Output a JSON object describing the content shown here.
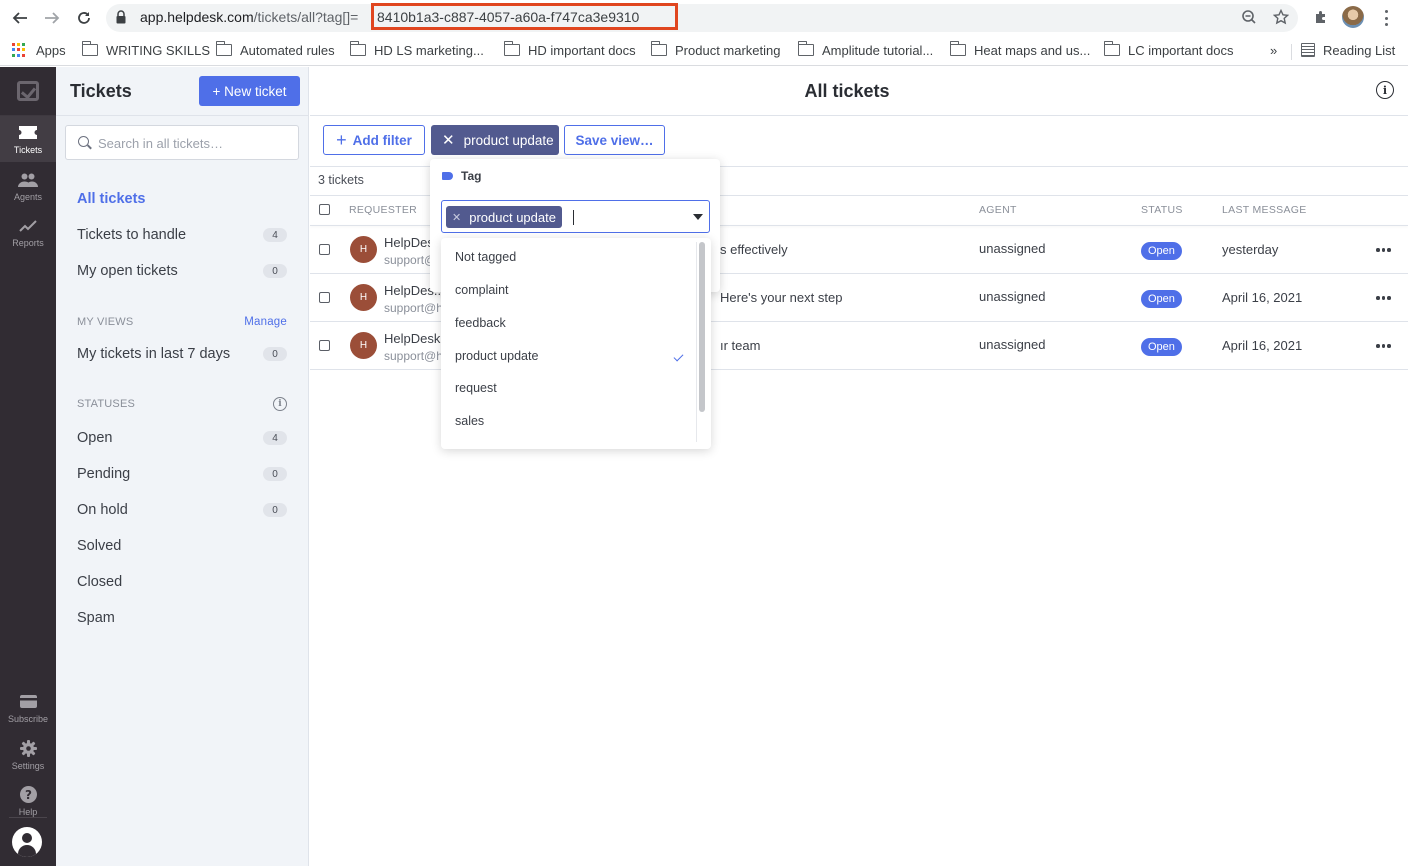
{
  "browser": {
    "url_host": "app.helpdesk.com",
    "url_path": "/tickets/all?tag[]=",
    "url_tag_id": "8410b1a3-c887-4057-a60a-f747ca3e9310",
    "bookmarks": [
      {
        "label": "Apps",
        "icon": "apps-grid-icon"
      },
      {
        "label": "WRITING SKILLS",
        "icon": "folder-icon"
      },
      {
        "label": "Automated rules",
        "icon": "folder-icon"
      },
      {
        "label": "HD LS marketing...",
        "icon": "folder-icon"
      },
      {
        "label": "HD important docs",
        "icon": "folder-icon"
      },
      {
        "label": "Product marketing",
        "icon": "folder-icon"
      },
      {
        "label": "Amplitude tutorial...",
        "icon": "folder-icon"
      },
      {
        "label": "Heat maps and us...",
        "icon": "folder-icon"
      },
      {
        "label": "LC important docs",
        "icon": "folder-icon"
      }
    ],
    "overflow_label": "»",
    "reading_list_label": "Reading List"
  },
  "rail": {
    "items": [
      {
        "label": "Tickets",
        "icon": "ticket-icon",
        "active": true
      },
      {
        "label": "Agents",
        "icon": "agents-icon"
      },
      {
        "label": "Reports",
        "icon": "reports-icon"
      }
    ],
    "bottom": [
      {
        "label": "Subscribe",
        "icon": "card-icon"
      },
      {
        "label": "Settings",
        "icon": "gear-icon"
      },
      {
        "label": "Help",
        "icon": "help-icon"
      }
    ]
  },
  "sidebar": {
    "title": "Tickets",
    "new_ticket_label": "+ New ticket",
    "search_placeholder": "Search in all tickets…",
    "views": [
      {
        "label": "All tickets",
        "active": true
      },
      {
        "label": "Tickets to handle",
        "count": "4"
      },
      {
        "label": "My open tickets",
        "count": "0"
      }
    ],
    "my_views_heading": "MY VIEWS",
    "manage_label": "Manage",
    "my_views": [
      {
        "label": "My tickets in last 7 days",
        "count": "0"
      }
    ],
    "statuses_heading": "STATUSES",
    "statuses": [
      {
        "label": "Open",
        "count": "4"
      },
      {
        "label": "Pending",
        "count": "0"
      },
      {
        "label": "On hold",
        "count": "0"
      },
      {
        "label": "Solved"
      },
      {
        "label": "Closed"
      },
      {
        "label": "Spam"
      }
    ]
  },
  "main": {
    "title": "All tickets",
    "add_filter_label": "Add filter",
    "active_filter_label": "product update",
    "save_view_label": "Save view…",
    "ticket_count": "3 tickets",
    "columns": {
      "requester": "REQUESTER",
      "agent": "AGENT",
      "status": "STATUS",
      "last_message": "LAST MESSAGE"
    },
    "rows": [
      {
        "avatar": "H",
        "name": "HelpDes",
        "email": "support@",
        "subject": "s effectively",
        "agent": "unassigned",
        "status": "Open",
        "last": "yesterday"
      },
      {
        "avatar": "H",
        "name": "HelpDes...",
        "email": "support@h",
        "subject": "Here's your next step",
        "agent": "unassigned",
        "status": "Open",
        "last": "April 16, 2021"
      },
      {
        "avatar": "H",
        "name": "HelpDesk",
        "email": "support@h",
        "subject": "ır team",
        "agent": "unassigned",
        "status": "Open",
        "last": "April 16, 2021"
      }
    ]
  },
  "tag_filter": {
    "heading": "Tag",
    "selected": [
      "product update"
    ],
    "input_value": "",
    "options": [
      {
        "label": "Not tagged",
        "checked": false
      },
      {
        "label": "complaint",
        "checked": false
      },
      {
        "label": "feedback",
        "checked": false
      },
      {
        "label": "product update",
        "checked": true
      },
      {
        "label": "request",
        "checked": false
      },
      {
        "label": "sales",
        "checked": false
      }
    ]
  },
  "colors": {
    "accent": "#4f6fe8",
    "chip": "#525a8f",
    "rail_bg": "#312c33",
    "sidebar_bg": "#f1f4f8",
    "avatar": "#9b4e38",
    "url_highlight": "#e0461f"
  }
}
